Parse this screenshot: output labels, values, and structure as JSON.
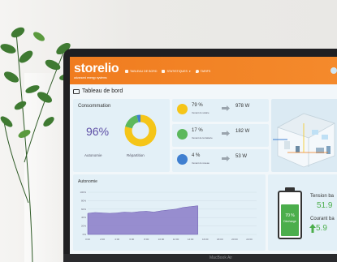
{
  "app": {
    "brand": "storelio",
    "brand_tagline": "advanced energy systems",
    "nav": [
      {
        "label": "TABLEAU DE BORD",
        "icon": "dashboard-icon"
      },
      {
        "label": "STATISTIQUES",
        "icon": "chart-icon"
      },
      {
        "label": "TARIFS",
        "icon": "drop-icon"
      }
    ],
    "laptop_label": "MacBook Air"
  },
  "page": {
    "title": "Tableau de bord"
  },
  "consumption": {
    "title": "Consommation",
    "autonomy_percent": "96%",
    "autonomy_label": "Autonomie",
    "split_label": "Répartition",
    "split": [
      {
        "share": 0.79,
        "color": "#f5c518"
      },
      {
        "share": 0.17,
        "color": "#5cb85c"
      },
      {
        "share": 0.04,
        "color": "#3f7fd0"
      }
    ]
  },
  "sources": [
    {
      "percent": "79 %",
      "label": "Venant du solaire",
      "value": "978 W",
      "color": "#f5c518",
      "icon": "sun-icon"
    },
    {
      "percent": "17 %",
      "label": "Venant de la batterie",
      "value": "182 W",
      "color": "#5cb85c",
      "icon": "battery-icon"
    },
    {
      "percent": "4 %",
      "label": "Venant du réseau",
      "value": "53 W",
      "color": "#3f7fd0",
      "icon": "plug-icon"
    }
  ],
  "battery": {
    "percent": "70 %",
    "level": 0.7,
    "state": "Décharge",
    "voltage_label": "Tension ba",
    "voltage_value": "51.9",
    "current_label": "Courant ba",
    "current_value": "5.9"
  },
  "autonomy_chart": {
    "title": "Autonomie"
  },
  "chart_data": {
    "type": "area",
    "title": "Autonomie",
    "xlabel": "",
    "ylabel": "",
    "ylim": [
      0,
      100
    ],
    "x": [
      "0:00",
      "1:00",
      "2:00",
      "3:00",
      "4:00",
      "5:00",
      "6:00",
      "7:00",
      "8:00",
      "9:00",
      "10:00",
      "11:00",
      "12:00",
      "13:00",
      "14:00",
      "15:00",
      "16:00",
      "17:00",
      "18:00",
      "19:00",
      "20:00",
      "21:00",
      "22:00",
      "23:00"
    ],
    "series": [
      {
        "values": [
          50,
          52,
          51,
          50,
          51,
          53,
          52,
          54,
          55,
          53,
          56,
          58,
          60,
          64,
          66,
          68,
          0,
          0,
          0,
          0,
          0,
          0,
          0,
          0
        ]
      }
    ],
    "color": "#8a7bc8"
  }
}
